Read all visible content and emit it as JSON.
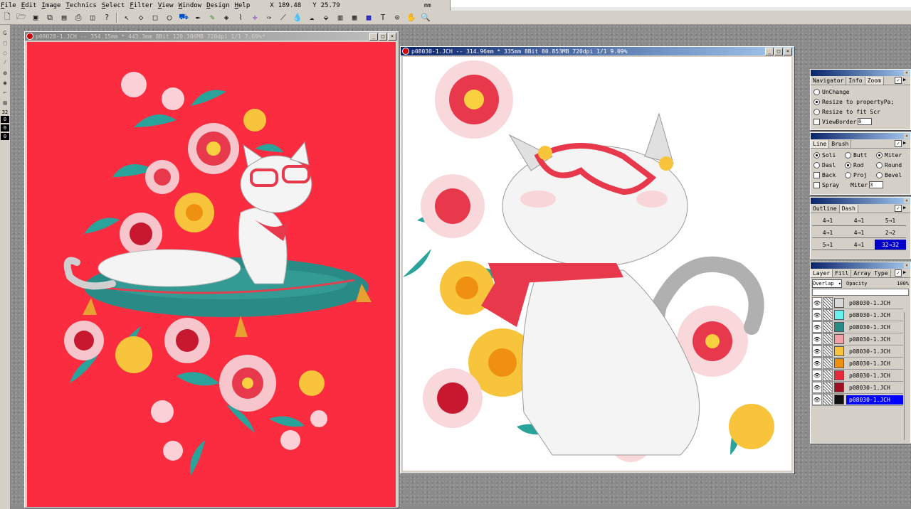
{
  "menu": {
    "items": [
      {
        "id": "file",
        "underline": "F",
        "rest": "ile"
      },
      {
        "id": "edit",
        "underline": "E",
        "rest": "dit"
      },
      {
        "id": "image",
        "underline": "I",
        "rest": "mage"
      },
      {
        "id": "technics",
        "underline": "T",
        "rest": "echnics"
      },
      {
        "id": "select",
        "underline": "S",
        "rest": "elect"
      },
      {
        "id": "filter",
        "underline": "F",
        "rest": "ilter"
      },
      {
        "id": "view",
        "underline": "V",
        "rest": "iew"
      },
      {
        "id": "window",
        "underline": "W",
        "rest": "indow"
      },
      {
        "id": "design",
        "underline": "D",
        "rest": "esign"
      },
      {
        "id": "help",
        "underline": "H",
        "rest": "elp"
      }
    ],
    "coord_x_label": "X",
    "coord_x_value": "189.48",
    "coord_y_label": "Y",
    "coord_y_value": "25.79",
    "units": "mm"
  },
  "left_tools": {
    "size_value": "32",
    "field_a": "0",
    "field_b": "0",
    "field_c": "0"
  },
  "window_left": {
    "title": "p08028-1.JCH -- 354.15mm * 443.3mm 8Bit 120.306MB 720dpi 1/1  7.69%*",
    "bg_color": "#fc2c40"
  },
  "window_right": {
    "title": "p08030-1.JCH -- 314.96mm * 335mm 8Bit  80.853MB 720dpi 1/1  9.09%",
    "bg_color": "#ffffff"
  },
  "navigator": {
    "tabs": [
      "Navigator",
      "Info",
      "Zoom"
    ],
    "active_tab": 2,
    "options": [
      "UnChange",
      "Resize to propertyPa;",
      "Resize to fit Scr"
    ],
    "checkbox_label": "ViewBorder",
    "checkbox_value": "0"
  },
  "line_palette": {
    "tabs": [
      "Line",
      "Brush"
    ],
    "active_tab": 0,
    "col1": [
      "Soli",
      "Dasl",
      "Back",
      "Spray"
    ],
    "col2": [
      "Butt",
      "Rod",
      "Proj",
      "Miter"
    ],
    "col3": [
      "Miter",
      "Round",
      "Bevel"
    ],
    "miter_value": "3"
  },
  "outline_palette": {
    "tabs": [
      "Outline",
      "Dash"
    ],
    "active_tab": 1,
    "cells": [
      "4→1",
      "4→1",
      "5→1",
      "4→1",
      "4→1",
      "2→2",
      "5→1",
      "4→1",
      "32→32"
    ],
    "selected_cell": 8
  },
  "layer_palette": {
    "tabs": [
      "Layer",
      "Fill",
      "Array Type"
    ],
    "active_tab": 0,
    "mode": "Overlap",
    "opacity_label": "Opacity",
    "opacity_value": "100%",
    "layers": [
      {
        "name": "p08030-1.JCH",
        "color": "#d8d8d8"
      },
      {
        "name": "p08030-1.JCH",
        "color": "#66f0f0"
      },
      {
        "name": "p08030-1.JCH",
        "color": "#2a8a86"
      },
      {
        "name": "p08030-1.JCH",
        "color": "#f4a0a8"
      },
      {
        "name": "p08030-1.JCH",
        "color": "#f8c43c"
      },
      {
        "name": "p08030-1.JCH",
        "color": "#f09010"
      },
      {
        "name": "p08030-1.JCH",
        "color": "#e82838"
      },
      {
        "name": "p08030-1.JCH",
        "color": "#a01020"
      },
      {
        "name": "p08030-1.JCH",
        "color": "#101010"
      }
    ],
    "selected_layer": 8
  }
}
